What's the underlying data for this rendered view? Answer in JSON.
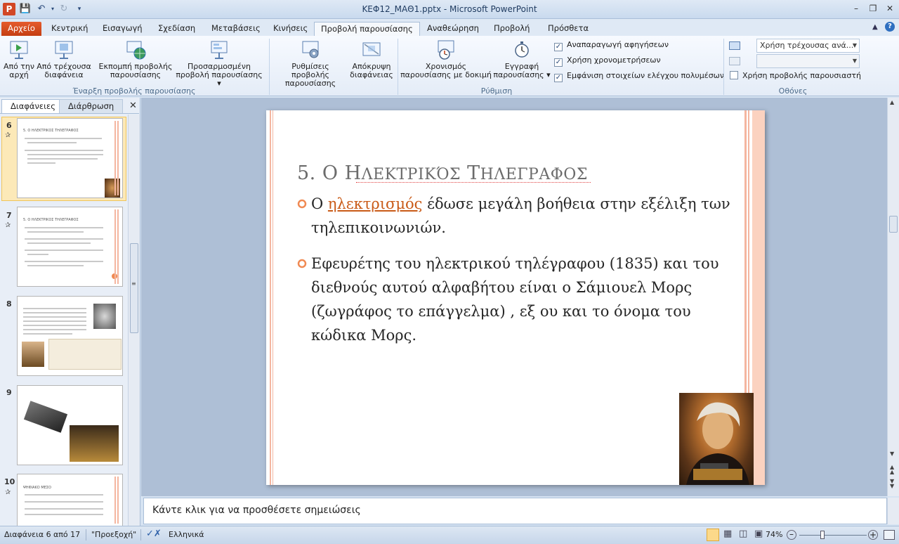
{
  "window": {
    "title": "ΚΕΦ12_ΜΑΘ1.pptx  -  Microsoft PowerPoint",
    "app_icon": "P"
  },
  "qat": {
    "save": "save-icon",
    "undo": "undo-icon",
    "redo": "redo-icon",
    "customize": "customize-icon"
  },
  "tabs": [
    "Αρχείο",
    "Κεντρική",
    "Εισαγωγή",
    "Σχεδίαση",
    "Μεταβάσεις",
    "Κινήσεις",
    "Προβολή παρουσίασης",
    "Αναθεώρηση",
    "Προβολή",
    "Πρόσθετα"
  ],
  "ribbon": {
    "start_group": {
      "label": "Έναρξη προβολής παρουσίασης",
      "buttons": [
        {
          "l1": "Από την",
          "l2": "αρχή"
        },
        {
          "l1": "Από τρέχουσα",
          "l2": "διαφάνεια"
        },
        {
          "l1": "Εκπομπή προβολής",
          "l2": "παρουσίασης"
        },
        {
          "l1": "Προσαρμοσμένη",
          "l2": "προβολή παρουσίασης ▾"
        }
      ]
    },
    "setup_group": {
      "label": "Ρύθμιση",
      "buttons": [
        {
          "l1": "Ρυθμίσεις προβολής",
          "l2": "παρουσίασης"
        },
        {
          "l1": "Απόκρυψη",
          "l2": "διαφάνειας"
        },
        {
          "l1": "Χρονισμός",
          "l2": "παρουσίασης με δοκιμή"
        },
        {
          "l1": "Εγγραφή",
          "l2": "παρουσίασης ▾"
        }
      ],
      "checks": [
        "Αναπαραγωγή αφηγήσεων",
        "Χρήση χρονομετρήσεων",
        "Εμφάνιση στοιχείων ελέγχου πολυμέσων"
      ]
    },
    "monitors_group": {
      "label": "Οθόνες",
      "dropdown1": "Χρήση τρέχουσας ανά...",
      "dropdown2": "",
      "presenter_view": "Χρήση προβολής παρουσιαστή"
    }
  },
  "panel": {
    "tab_slides": "Διαφάνειες",
    "tab_outline": "Διάρθρωση",
    "close": "✕",
    "slides": [
      {
        "num": "6",
        "has_anim": true
      },
      {
        "num": "7",
        "has_anim": true
      },
      {
        "num": "8",
        "has_anim": false
      },
      {
        "num": "9",
        "has_anim": false
      },
      {
        "num": "10",
        "has_anim": true
      }
    ],
    "thumb_text": {
      "s6_title": "5. Ο ΗΛΕΚΤΡΙΚΟΣ ΤΗΛΕΓΡΑΦΟΣ",
      "s7_title": "5. Ο ΗΛΕΚΤΡΙΚΟΣ ΤΗΛΕΓΡΑΦΟΣ",
      "s10_title": "ΨΗΦΙΑΚΟ ΜΕΣΟ"
    }
  },
  "slide": {
    "title_num": "5. Ο",
    "title_h1": "Η",
    "title_w1": "ΛΕΚΤΡΙΚΌΣ",
    "title_h2": "Τ",
    "title_w2": "ΗΛΕΓΡΑΦΟΣ",
    "b1_pre": "Ο ",
    "b1_link": "ηλεκτρισμός",
    "b1_post": " έδωσε μεγάλη βοήθεια στην εξέλιξη των τηλεπικοινωνιών.",
    "b2": "Εφευρέτης του ηλεκτρικού τηλέγραφου (1835) και του διεθνούς αυτού αλφαβήτου είναι ο Σάμιουελ Μορς (ζωγράφος το επάγγελμα) , εξ ου και το όνομα του κώδικα Μορς."
  },
  "notes": {
    "placeholder": "Κάντε κλικ για να προσθέσετε σημειώσεις"
  },
  "status": {
    "slide_info": "Διαφάνεια 6 από 17",
    "theme": "\"Προεξοχή\"",
    "language": "Ελληνικά",
    "zoom": "74%"
  },
  "colors": {
    "accent": "#f08a53",
    "file_tab": "#d9531e",
    "link": "#c95a17"
  }
}
